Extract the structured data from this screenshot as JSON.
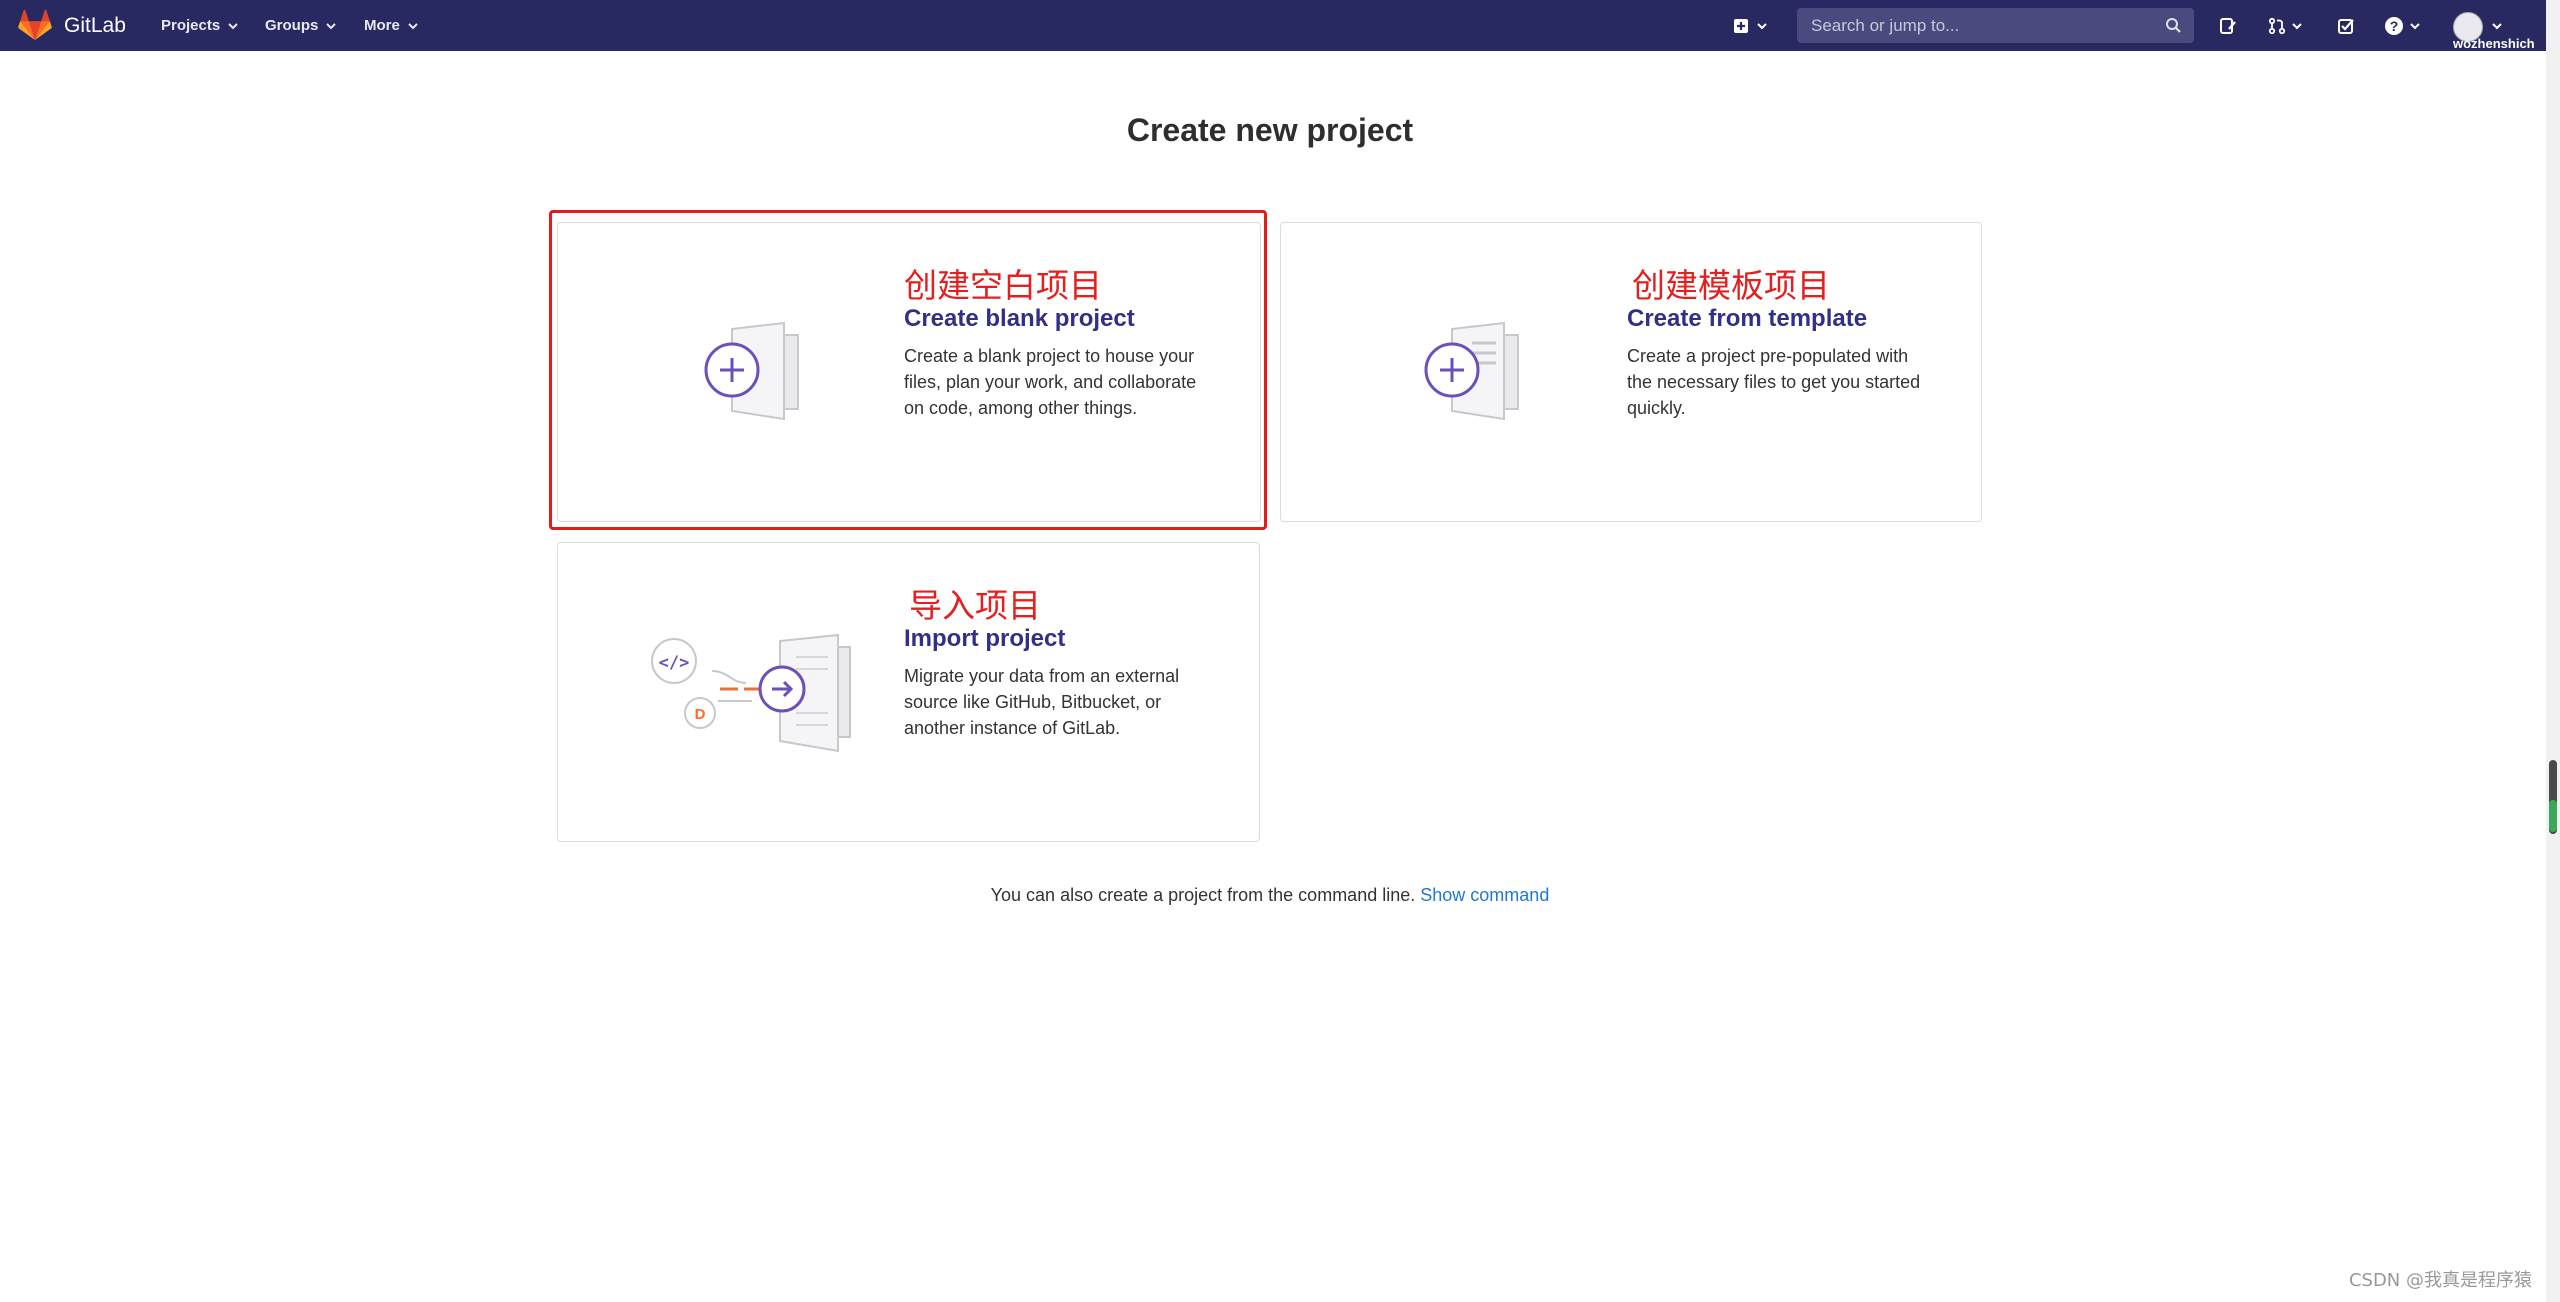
{
  "colors": {
    "navbar_bg": "#292961",
    "accent": "#6b4fbb",
    "highlight": "#e51b1b",
    "link": "#1f78d1",
    "panel_title": "#303087"
  },
  "navbar": {
    "brand": "GitLab",
    "menu": [
      {
        "label": "Projects",
        "icon": "chevron-down-icon"
      },
      {
        "label": "Groups",
        "icon": "chevron-down-icon"
      },
      {
        "label": "More",
        "icon": "chevron-down-icon"
      }
    ],
    "search_placeholder": "Search or jump to...",
    "username": "wozhenshich",
    "icons": [
      "new-plus-icon",
      "search-icon",
      "issues-icon",
      "merge-request-icon",
      "todo-icon",
      "help-icon",
      "user-avatar"
    ]
  },
  "page": {
    "title": "Create new project",
    "panels": [
      {
        "annotation": "创建空白项目",
        "title": "Create blank project",
        "description": "Create a blank project to house your files, plan your work, and collaborate on code, among other things."
      },
      {
        "annotation": "创建模板项目",
        "title": "Create from template",
        "description": "Create a project pre-populated with the necessary files to get you started quickly."
      },
      {
        "annotation": "导入项目",
        "title": "Import project",
        "description": "Migrate your data from an external source like GitHub, Bitbucket, or another instance of GitLab."
      }
    ],
    "cmdline_text": "You can also create a project from the command line.",
    "cmdline_link": "Show command"
  },
  "watermark": "CSDN @我真是程序猿"
}
